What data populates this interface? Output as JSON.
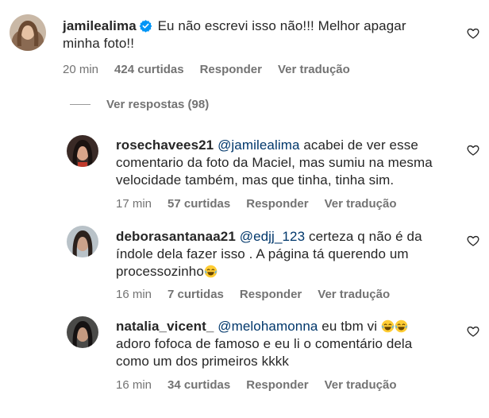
{
  "comments": [
    {
      "username": "jamilealima",
      "verified": true,
      "text_line1": "Eu não escrevi isso não!!! Melhor apagar",
      "text_line2": "minha foto!!",
      "time": "20 min",
      "likes": "424 curtidas",
      "reply": "Responder",
      "translate": "Ver tradução"
    }
  ],
  "view_replies": "Ver respostas (98)",
  "replies": [
    {
      "username": "rosechavees21",
      "mention": "@jamilealima",
      "text_line1": " acabei de ver esse",
      "text_line2": "comentario da foto da Maciel, mas sumiu na mesma",
      "text_line3": "velocidade também, mas que tinha, tinha sim.",
      "time": "17 min",
      "likes": "57 curtidas",
      "reply": "Responder",
      "translate": "Ver tradução"
    },
    {
      "username": "deborasantanaa21",
      "mention": "@edjj_123",
      "text_line1": " certeza q não é da",
      "text_line2": "índole dela fazer isso . A página tá querendo um",
      "text_line3": "processozinho",
      "time": "16 min",
      "likes": "7 curtidas",
      "reply": "Responder",
      "translate": "Ver tradução"
    },
    {
      "username": "natalia_vicent_",
      "mention": "@melohamonna",
      "text_line1": " eu tbm vi ",
      "text_line2": "adoro fofoca de famoso e eu li o comentário dela",
      "text_line3": "como um dos primeiros kkkk",
      "time": "16 min",
      "likes": "34 curtidas",
      "reply": "Responder",
      "translate": "Ver tradução"
    }
  ],
  "icons": {
    "like": "heart-outline-icon",
    "verified": "verified-badge-icon",
    "emoji": "tears-of-joy-emoji"
  },
  "colors": {
    "text": "#262626",
    "meta": "#737373",
    "mention": "#00376b",
    "verified": "#0095f6"
  }
}
